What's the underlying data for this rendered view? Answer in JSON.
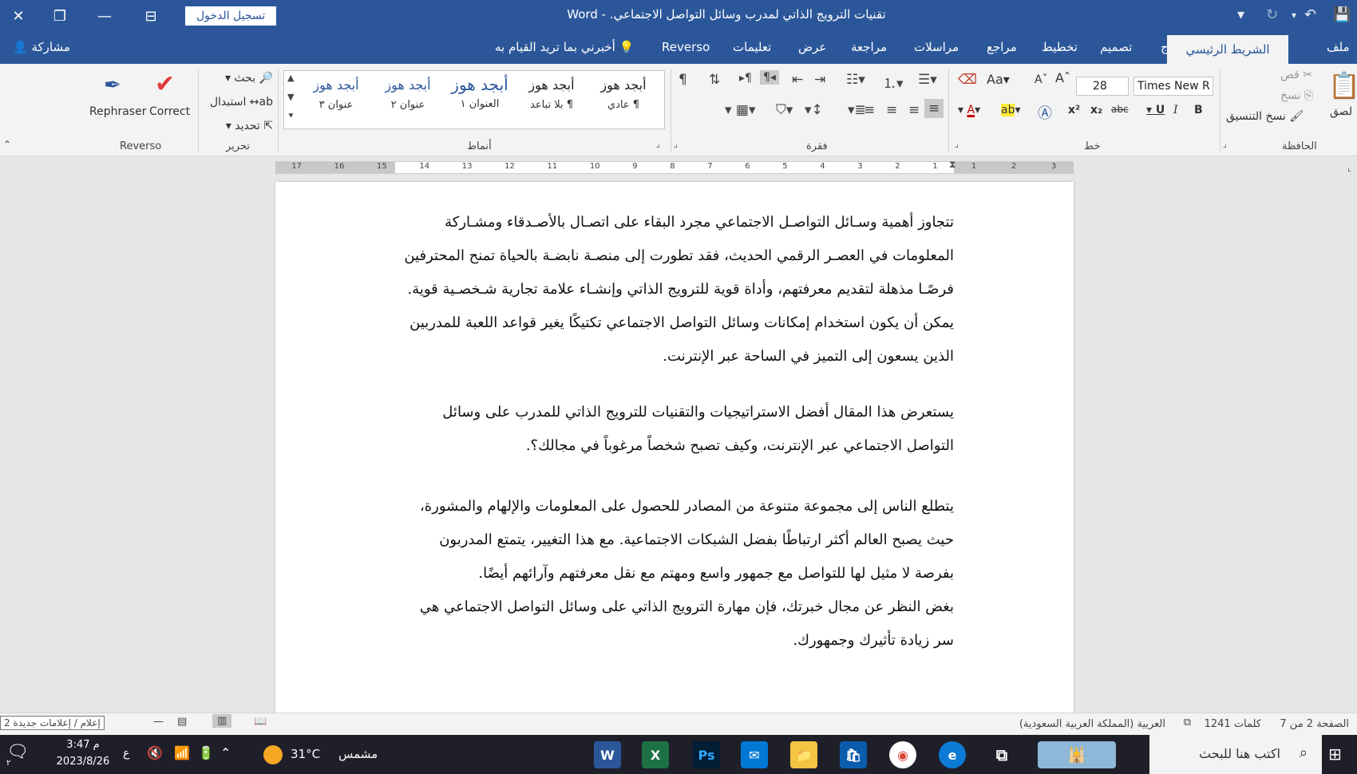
{
  "titlebar": {
    "doc_title": "تقنيات الترويج الذاتي لمدرب وسائل التواصل الاجتماعي.  -  Word",
    "sign_in": "تسجيل الدخول"
  },
  "tabs": {
    "file": "ملف",
    "home": "الشريط الرئيسي",
    "insert": "إدراج",
    "design": "تصميم",
    "layout": "تخطيط",
    "references": "مراجع",
    "mailings": "مراسلات",
    "review": "مراجعة",
    "view": "عرض",
    "help": "تعليمات",
    "reverso": "Reverso",
    "tell_me": "أخبرني بما تريد القيام به",
    "share": "مشاركة"
  },
  "ribbon": {
    "clipboard": {
      "group": "الحافظة",
      "paste": "لصق",
      "cut": "قص",
      "copy": "نسخ",
      "format_painter": "نسخ التنسيق"
    },
    "font": {
      "group": "خط",
      "name": "Times New R",
      "size": "28"
    },
    "paragraph": {
      "group": "فقرة"
    },
    "styles": {
      "group": "أنماط",
      "items": [
        {
          "preview": "أبجد هوز",
          "name": "¶ عادي"
        },
        {
          "preview": "أبجد هوز",
          "name": "¶ بلا تباعد"
        },
        {
          "preview": "أبجد هوز",
          "name": "العنوان ١"
        },
        {
          "preview": "أبجد هوز",
          "name": "عنوان ٢"
        },
        {
          "preview": "أبجد هوز",
          "name": "عنوان ٣"
        }
      ]
    },
    "editing": {
      "group": "تحرير",
      "find": "بحث",
      "replace": "استبدال",
      "select": "تحديد"
    },
    "reverso": {
      "group": "Reverso",
      "rephraser": "Rephraser",
      "correct": "Correct"
    }
  },
  "ruler": {
    "left_numbers": [
      "17",
      "16",
      "15",
      "14",
      "13",
      "12",
      "11",
      "10",
      "9",
      "8",
      "7",
      "6",
      "5",
      "4",
      "3",
      "2",
      "1"
    ],
    "right_numbers": [
      "1",
      "2",
      "3"
    ]
  },
  "document": {
    "paragraphs": [
      {
        "lines": [
          "تتجاوز أهمية وسـائل التواصـل الاجتماعي مجرد البقاء على اتصـال بالأصـدقاء ومشـاركة",
          "المعلومات في العصـر الرقمي الحديث، فقد تطورت إلى منصـة نابضـة بالحياة تمنح المحترفين",
          "فرصًـا مذهلة لتقديم معرفتهم، وأداة قوية للترويج الذاتي وإنشـاء علامة تجارية شـخصـية قوية.",
          "يمكن أن يكون استخدام إمكانات وسائل التواصل الاجتماعي تكتيكًا يغير قواعد اللعبة للمدربين",
          "الذين يسعون إلى التميز في الساحة عبر الإنترنت."
        ]
      },
      {
        "lines": [
          "يستعرض هذا المقال أفضل الاستراتيجيات والتقنيات للترويج الذاتي للمدرب على وسائل",
          "التواصل الاجتماعي عبر الإنترنت، وكيف تصبح شخصاً مرغوباً في مجالك؟."
        ]
      },
      {
        "lines": [
          "يتطلع الناس إلى مجموعة متنوعة من المصادر للحصول على المعلومات والإلهام والمشورة،",
          "حيث يصبح العالم أكثر ارتباطًا بفضل الشبكات الاجتماعية. مع هذا التغيير، يتمتع المدربون",
          "بفرصة لا مثيل لها للتواصل مع جمهور واسع ومهتم مع نقل معرفتهم وآرائهم أيضًا.",
          "بغض النظر عن مجال خبرتك، فإن مهارة الترويج الذاتي على وسائل التواصل الاجتماعي هي",
          "سر زيادة تأثيرك وجمهورك."
        ]
      }
    ]
  },
  "statusbar": {
    "page": "الصفحة 2 من 7",
    "words": "1241 كلمات",
    "language": "العربية (المملكة العربية السعودية)",
    "notifications": "2 إعلام / إعلامات جديدة"
  },
  "taskbar": {
    "search_placeholder": "اكتب هنا للبحث",
    "weather_temp": "31°C",
    "weather_desc": "مشمس",
    "time": "3:47 م",
    "date": "2023/8/26",
    "lang": "ع",
    "notification_count": "٢"
  },
  "colors": {
    "word_blue": "#2b579a",
    "ribbon_bg": "#f3f3f3",
    "taskbar_bg": "#1f1f2a"
  }
}
